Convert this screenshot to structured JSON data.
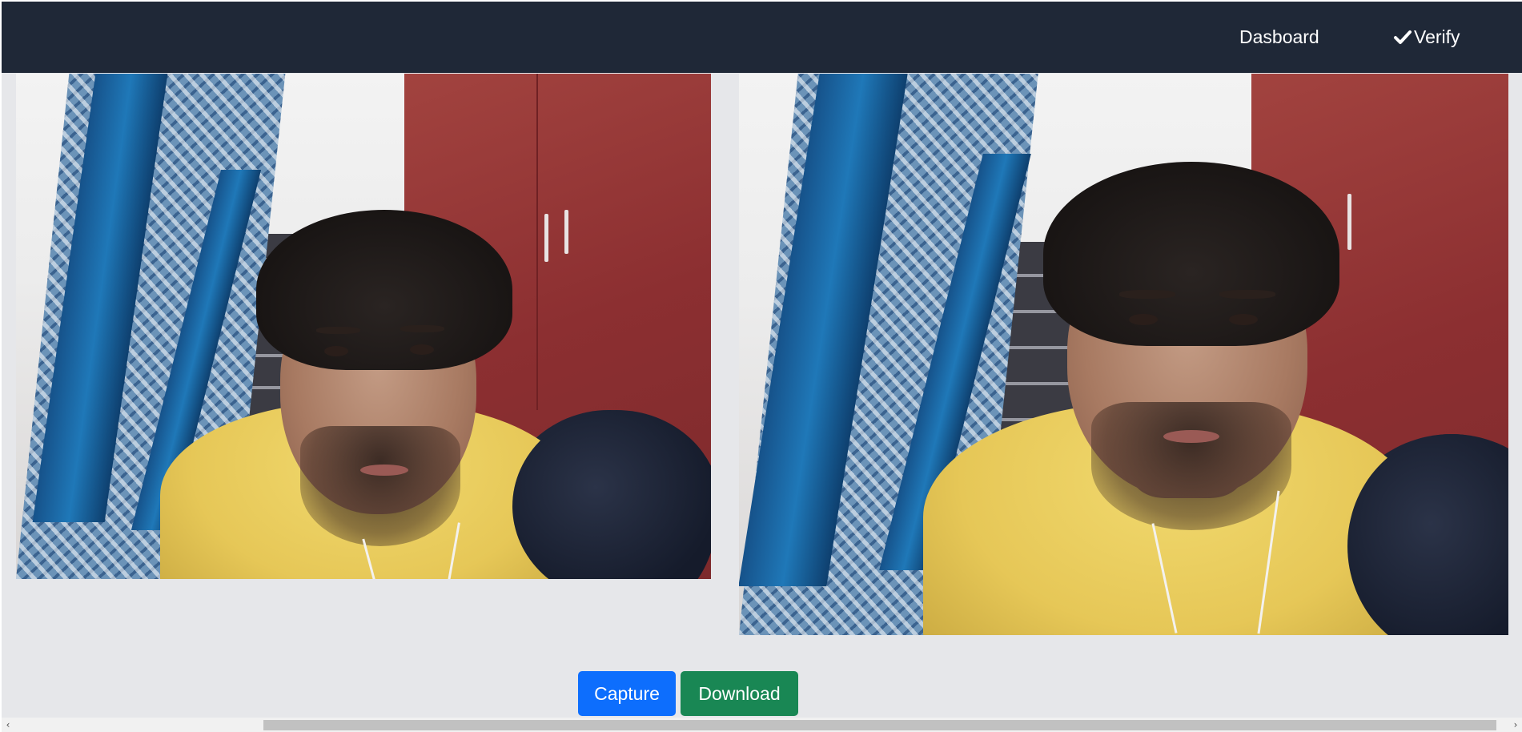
{
  "navbar": {
    "links": [
      {
        "label": "Dasboard"
      },
      {
        "label": "Verify",
        "icon": "check-icon"
      }
    ]
  },
  "media": {
    "left_frame": {
      "description": "webcam-feed"
    },
    "right_frame": {
      "description": "captured-photo"
    }
  },
  "actions": {
    "capture_label": "Capture",
    "download_label": "Download"
  },
  "scrollbar": {
    "left_arrow": "‹",
    "right_arrow": "›"
  },
  "colors": {
    "navbar_bg": "#1f2837",
    "page_bg": "#e6e7ea",
    "capture_button": "#0d6efd",
    "download_button": "#198754"
  }
}
